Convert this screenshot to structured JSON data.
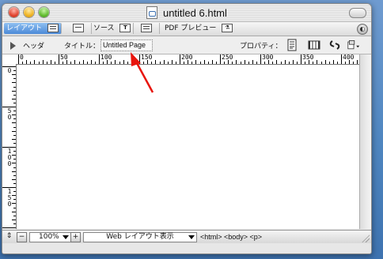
{
  "window": {
    "title": "untitled 6.html"
  },
  "viewbar": {
    "layout_label": "レイアウト",
    "source_label": "ソース",
    "pdf_label": "PDF プレビュー"
  },
  "headerbar": {
    "header_label": "ヘッダ",
    "title_label": "タイトル：",
    "title_value": "Untitled Page",
    "properties_label": "プロパティ："
  },
  "ruler": {
    "top_labels": [
      "0",
      "50",
      "100",
      "150",
      "200",
      "250",
      "300",
      "350",
      "400"
    ],
    "left_labels": [
      "0",
      "50",
      "100",
      "150"
    ]
  },
  "statusbar": {
    "zoom_value": "100%",
    "view_mode": "Web レイアウト表示",
    "breadcrumb": "<html> <body> <p>"
  },
  "annotation": {
    "arrow_color": "#e8150d"
  }
}
